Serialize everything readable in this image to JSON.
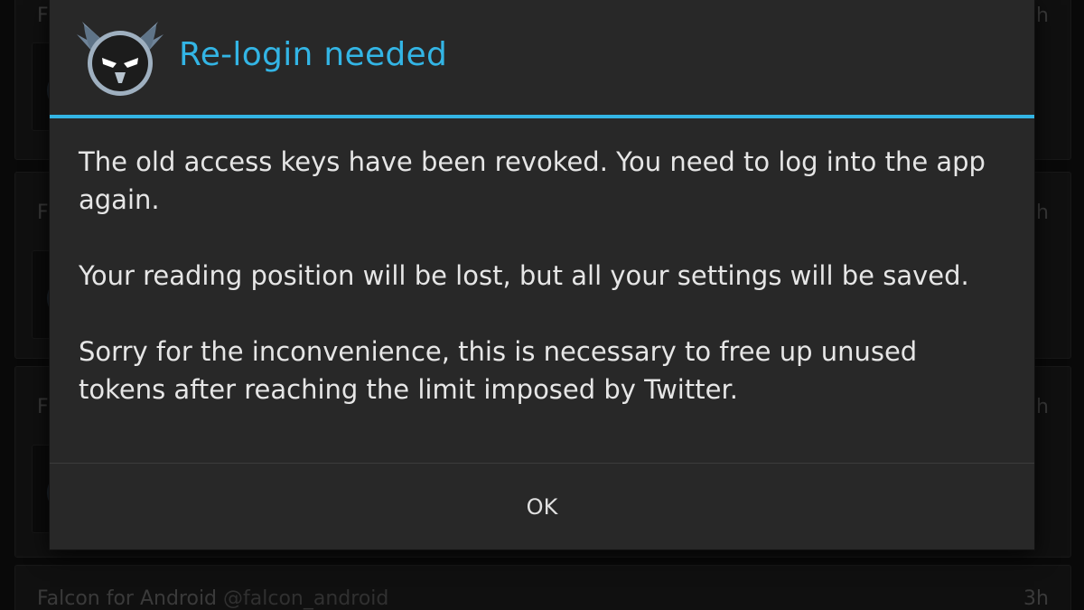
{
  "timeline": {
    "cards": [
      {
        "author": "F",
        "handle": "",
        "time": "3h"
      },
      {
        "author": "F",
        "handle": "",
        "time": "3h"
      },
      {
        "author": "F",
        "handle": "",
        "time": "3h"
      },
      {
        "author": "Falcon for Android",
        "handle": "@falcon_android",
        "time": "3h"
      }
    ]
  },
  "dialog": {
    "title": "Re-login needed",
    "paragraphs": [
      "The old access keys have been revoked. You need to log into the app again.",
      "Your reading position will be lost, but all your settings will be saved.",
      "Sorry for the inconvenience, this is necessary to free up unused tokens after reaching the limit imposed by Twitter."
    ],
    "ok_label": "OK"
  },
  "colors": {
    "accent": "#33b5e5",
    "dialog_bg": "#282828",
    "body_text": "#e6e6e6"
  },
  "icons": {
    "app_logo": "falcon-logo-icon"
  }
}
